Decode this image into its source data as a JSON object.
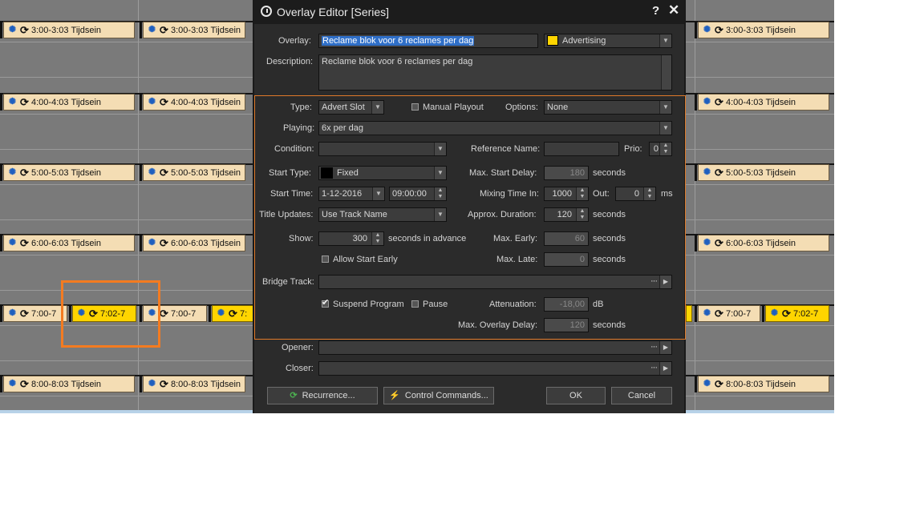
{
  "schedule": {
    "slot_times": [
      "3:00-3:03",
      "4:00-4:03",
      "5:00-5:03",
      "6:00-6:03",
      "8:00-8:03"
    ],
    "slot_title": "Tijdsein",
    "row7_left": "7:00-7",
    "row7_yellow": "7:02-7",
    "row7_col2_left": "7:00-7",
    "row7_col2_trunc": "7:",
    "row7_right_left": "7:00-7",
    "row7_right_yellow": "7:02-7"
  },
  "dialog": {
    "title": "Overlay Editor [Series]",
    "help_label": "?",
    "close_label": "✕",
    "overlay_label": "Overlay:",
    "overlay_value": "Reclame blok voor 6 reclames per dag",
    "category_value": "Advertising",
    "category_color": "#ffd500",
    "description_label": "Description:",
    "description_value": "Reclame blok voor 6 reclames per dag",
    "type_label": "Type:",
    "type_value": "Advert Slot",
    "manual_playout_label": "Manual Playout",
    "manual_playout_checked": false,
    "options_label": "Options:",
    "options_value": "None",
    "playing_label": "Playing:",
    "playing_value": "6x per dag",
    "condition_label": "Condition:",
    "condition_value": "",
    "reference_name_label": "Reference Name:",
    "reference_name_value": "",
    "prio_label": "Prio:",
    "prio_value": "0",
    "start_type_label": "Start Type:",
    "start_type_value": "Fixed",
    "start_type_color": "#000000",
    "max_start_delay_label": "Max. Start Delay:",
    "max_start_delay_value": "180",
    "seconds_label": "seconds",
    "start_time_label": "Start Time:",
    "start_date_value": "1-12-2016",
    "start_time_value": "09:00:00",
    "mixing_time_in_label": "Mixing Time In:",
    "mixing_time_in_value": "1000",
    "out_label": "Out:",
    "out_value": "0",
    "ms_label": "ms",
    "title_updates_label": "Title Updates:",
    "title_updates_value": "Use Track Name",
    "approx_duration_label": "Approx. Duration:",
    "approx_duration_value": "120",
    "show_label": "Show:",
    "show_value": "300",
    "seconds_in_advance_label": "seconds in advance",
    "max_early_label": "Max. Early:",
    "max_early_value": "60",
    "allow_start_early_label": "Allow Start Early",
    "allow_start_early_checked": false,
    "max_late_label": "Max. Late:",
    "max_late_value": "0",
    "bridge_track_label": "Bridge Track:",
    "bridge_track_value": "",
    "suspend_program_label": "Suspend Program",
    "suspend_program_checked": true,
    "pause_label": "Pause",
    "pause_checked": false,
    "attenuation_label": "Attenuation:",
    "attenuation_value": "-18,00",
    "db_label": "dB",
    "max_overlay_delay_label": "Max. Overlay Delay:",
    "max_overlay_delay_value": "120",
    "opener_label": "Opener:",
    "opener_value": "",
    "closer_label": "Closer:",
    "closer_value": "",
    "recurrence_button": "Recurrence...",
    "control_commands_button": "Control Commands...",
    "ok_button": "OK",
    "cancel_button": "Cancel"
  },
  "icons": {
    "slot_icon_1": "lightbulb-icon",
    "slot_icon_2": "sync-icon",
    "title_icon": "clock-icon",
    "recurrence_icon": "recurrence-icon",
    "control_icon": "lightning-icon"
  },
  "colors": {
    "slot_bg": "#f4ddb4",
    "slot_highlight": "#ffd500",
    "callout": "#f47b20",
    "dialog_bg": "#2b2b2b"
  }
}
